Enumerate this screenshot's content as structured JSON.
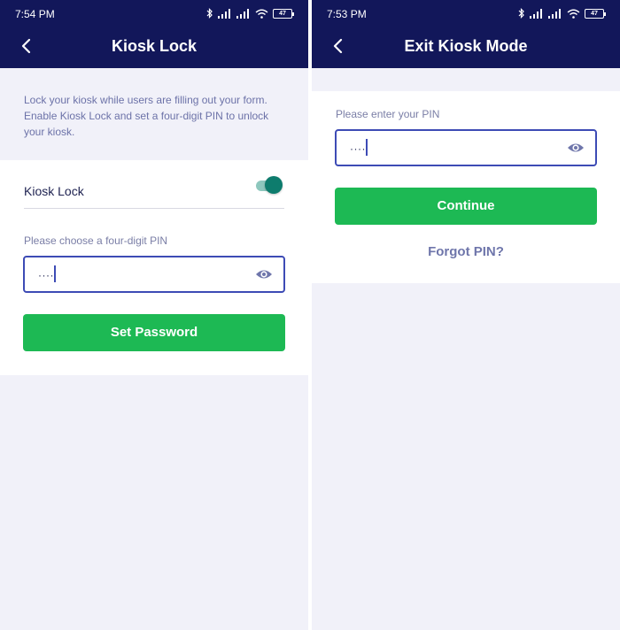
{
  "left_screen": {
    "status": {
      "time": "7:54 PM",
      "battery": "47"
    },
    "header": {
      "title": "Kiosk Lock",
      "back_icon": "chevron-left-icon"
    },
    "description": "Lock your kiosk while users are filling out your form. Enable Kiosk Lock and set a four-digit PIN to unlock your kiosk.",
    "toggle": {
      "label": "Kiosk Lock",
      "enabled": true
    },
    "pin": {
      "label": "Please choose a four-digit PIN",
      "value": "····",
      "eye_icon": "eye-icon"
    },
    "button_label": "Set Password"
  },
  "right_screen": {
    "status": {
      "time": "7:53 PM",
      "battery": "47"
    },
    "header": {
      "title": "Exit Kiosk Mode",
      "back_icon": "chevron-left-icon"
    },
    "pin": {
      "label": "Please enter your PIN",
      "value": "····",
      "eye_icon": "eye-icon"
    },
    "button_label": "Continue",
    "forgot_label": "Forgot PIN?"
  },
  "colors": {
    "header_bg": "#12175a",
    "page_bg": "#f1f1f9",
    "accent_green": "#1db954",
    "field_border": "#3d4bb5",
    "toggle_on": "#0d7c6d"
  }
}
